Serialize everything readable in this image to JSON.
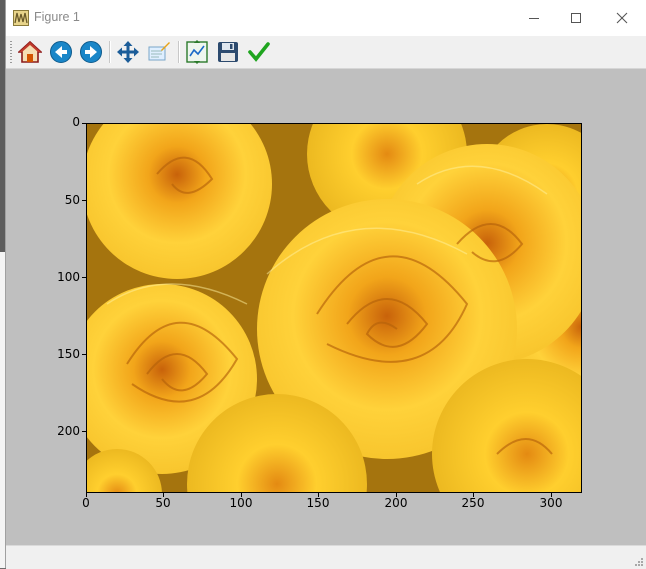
{
  "window": {
    "title": "Figure 1",
    "controls": [
      "minimize",
      "maximize",
      "close"
    ]
  },
  "toolbar": {
    "buttons": [
      {
        "id": "home",
        "icon": "home-icon"
      },
      {
        "id": "back",
        "icon": "arrow-left-icon"
      },
      {
        "id": "forward",
        "icon": "arrow-right-icon"
      },
      {
        "id": "pan",
        "icon": "pan-arrows-icon"
      },
      {
        "id": "zoom",
        "icon": "zoom-rect-icon"
      },
      {
        "id": "subplots",
        "icon": "subplots-config-icon"
      },
      {
        "id": "save",
        "icon": "floppy-save-icon"
      },
      {
        "id": "edit",
        "icon": "checkmark-edit-icon"
      }
    ]
  },
  "figure": {
    "image_subject": "yellow roses",
    "colors": {
      "canvas_bg": "#bfbfbf",
      "rose_base": "#f2b51a",
      "rose_highlight": "#ffe04a",
      "rose_shadow": "#b86a06"
    },
    "x_ticks": [
      "0",
      "50",
      "100",
      "150",
      "200",
      "250",
      "300"
    ],
    "y_ticks": [
      "0",
      "50",
      "100",
      "150",
      "200"
    ],
    "x_extent": [
      0,
      320
    ],
    "y_extent": [
      0,
      240
    ]
  }
}
